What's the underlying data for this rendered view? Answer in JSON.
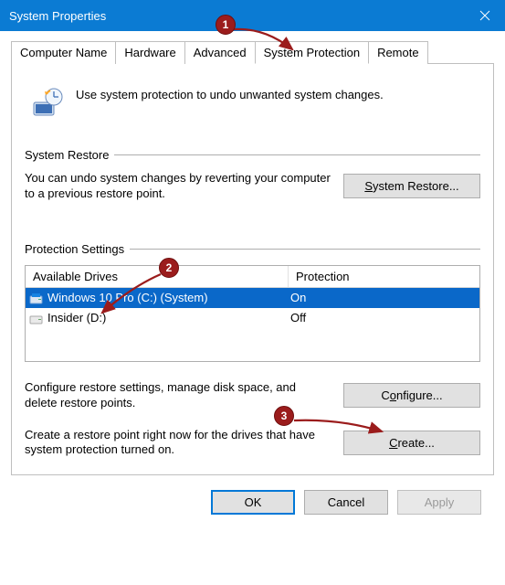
{
  "window": {
    "title": "System Properties"
  },
  "tabs": [
    {
      "label": "Computer Name"
    },
    {
      "label": "Hardware"
    },
    {
      "label": "Advanced"
    },
    {
      "label": "System Protection",
      "active": true
    },
    {
      "label": "Remote"
    }
  ],
  "intro": "Use system protection to undo unwanted system changes.",
  "section_restore": {
    "title": "System Restore",
    "desc": "You can undo system changes by reverting your computer to a previous restore point.",
    "button": "System Restore..."
  },
  "section_settings": {
    "title": "Protection Settings",
    "col_drive": "Available Drives",
    "col_protection": "Protection",
    "drives": [
      {
        "name": "Windows 10 Pro (C:) (System)",
        "protection": "On",
        "selected": true
      },
      {
        "name": "Insider (D:)",
        "protection": "Off",
        "selected": false
      }
    ],
    "configure_desc": "Configure restore settings, manage disk space, and delete restore points.",
    "configure_button": "Configure...",
    "create_desc": "Create a restore point right now for the drives that have system protection turned on.",
    "create_button": "Create..."
  },
  "footer": {
    "ok": "OK",
    "cancel": "Cancel",
    "apply": "Apply"
  },
  "annotations": [
    {
      "n": "1"
    },
    {
      "n": "2"
    },
    {
      "n": "3"
    }
  ]
}
